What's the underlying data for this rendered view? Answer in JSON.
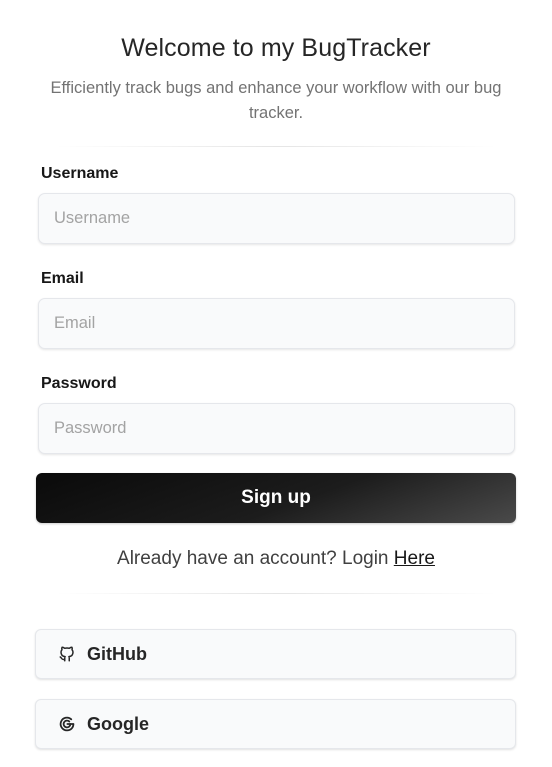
{
  "header": {
    "title": "Welcome to my BugTracker",
    "subtitle": "Efficiently track bugs and enhance your workflow with our bug tracker."
  },
  "form": {
    "username": {
      "label": "Username",
      "placeholder": "Username",
      "value": ""
    },
    "email": {
      "label": "Email",
      "placeholder": "Email",
      "value": ""
    },
    "password": {
      "label": "Password",
      "placeholder": "Password",
      "value": ""
    },
    "submit_label": "Sign up"
  },
  "login": {
    "prompt": "Already have an account? Login ",
    "link_label": "Here"
  },
  "social": {
    "github": {
      "label": "GitHub",
      "icon": "github-icon"
    },
    "google": {
      "label": "Google",
      "icon": "google-icon"
    }
  },
  "colors": {
    "button_dark": "#0a0a0a",
    "input_bg": "#f9fafb",
    "border": "#e5e7eb"
  }
}
